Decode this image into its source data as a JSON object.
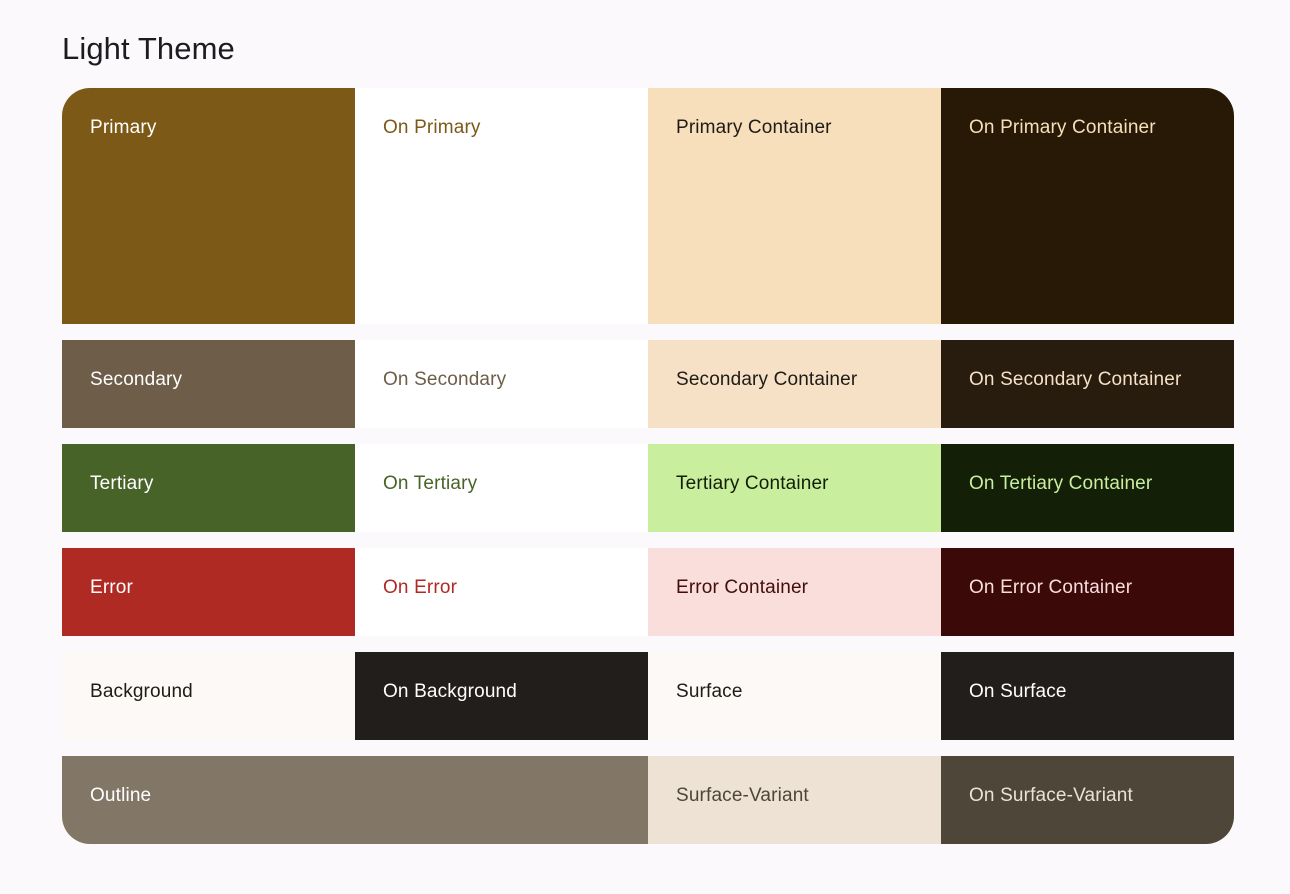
{
  "page": {
    "title": "Light Theme",
    "background_color": "#FCF9FC"
  },
  "palette": {
    "rows": [
      {
        "name": "primary",
        "cells": [
          {
            "label": "Primary",
            "bg": "#7D5917",
            "fg": "#FFFFFF"
          },
          {
            "label": "On Primary",
            "bg": "#FFFFFF",
            "fg": "#7D5917"
          },
          {
            "label": "Primary Container",
            "bg": "#F8DFBB",
            "fg": "#1F1B16"
          },
          {
            "label": "On Primary Container",
            "bg": "#271905",
            "fg": "#F8DFBB"
          }
        ]
      },
      {
        "name": "secondary",
        "cells": [
          {
            "label": "Secondary",
            "bg": "#6E5D48",
            "fg": "#FFFFFF"
          },
          {
            "label": "On Secondary",
            "bg": "#FFFFFF",
            "fg": "#6E5D48"
          },
          {
            "label": "Secondary Container",
            "bg": "#F6E0C6",
            "fg": "#1F1B16"
          },
          {
            "label": "On Secondary Container",
            "bg": "#271C0E",
            "fg": "#F6E0C6"
          }
        ]
      },
      {
        "name": "tertiary",
        "cells": [
          {
            "label": "Tertiary",
            "bg": "#486327",
            "fg": "#FFFFFF"
          },
          {
            "label": "On Tertiary",
            "bg": "#FFFFFF",
            "fg": "#486327"
          },
          {
            "label": "Tertiary Container",
            "bg": "#C8EE9E",
            "fg": "#121F04"
          },
          {
            "label": "On Tertiary Container",
            "bg": "#141F07",
            "fg": "#C8EE9E"
          }
        ]
      },
      {
        "name": "error",
        "cells": [
          {
            "label": "Error",
            "bg": "#B02A24",
            "fg": "#FFFFFF"
          },
          {
            "label": "On Error",
            "bg": "#FFFFFF",
            "fg": "#B02A24"
          },
          {
            "label": "Error Container",
            "bg": "#F9DEDC",
            "fg": "#410E0B"
          },
          {
            "label": "On Error Container",
            "bg": "#3B0907",
            "fg": "#F9DEDC"
          }
        ]
      },
      {
        "name": "background-surface",
        "cells": [
          {
            "label": "Background",
            "bg": "#FCF9F6",
            "fg": "#1F1B16"
          },
          {
            "label": "On Background",
            "bg": "#211E1B",
            "fg": "#FFFFFF"
          },
          {
            "label": "Surface",
            "bg": "#FCF9F6",
            "fg": "#1F1B16"
          },
          {
            "label": "On Surface",
            "bg": "#211E1B",
            "fg": "#FFFFFF"
          }
        ]
      },
      {
        "name": "outline-surface-variant",
        "cells": [
          {
            "label": "Outline",
            "bg": "#827767",
            "fg": "#FFFFFF"
          },
          {
            "label": "Surface-Variant",
            "bg": "#EDE2D4",
            "fg": "#4D4639"
          },
          {
            "label": "On Surface-Variant",
            "bg": "#4D4639",
            "fg": "#EDE2D4"
          }
        ]
      }
    ]
  }
}
